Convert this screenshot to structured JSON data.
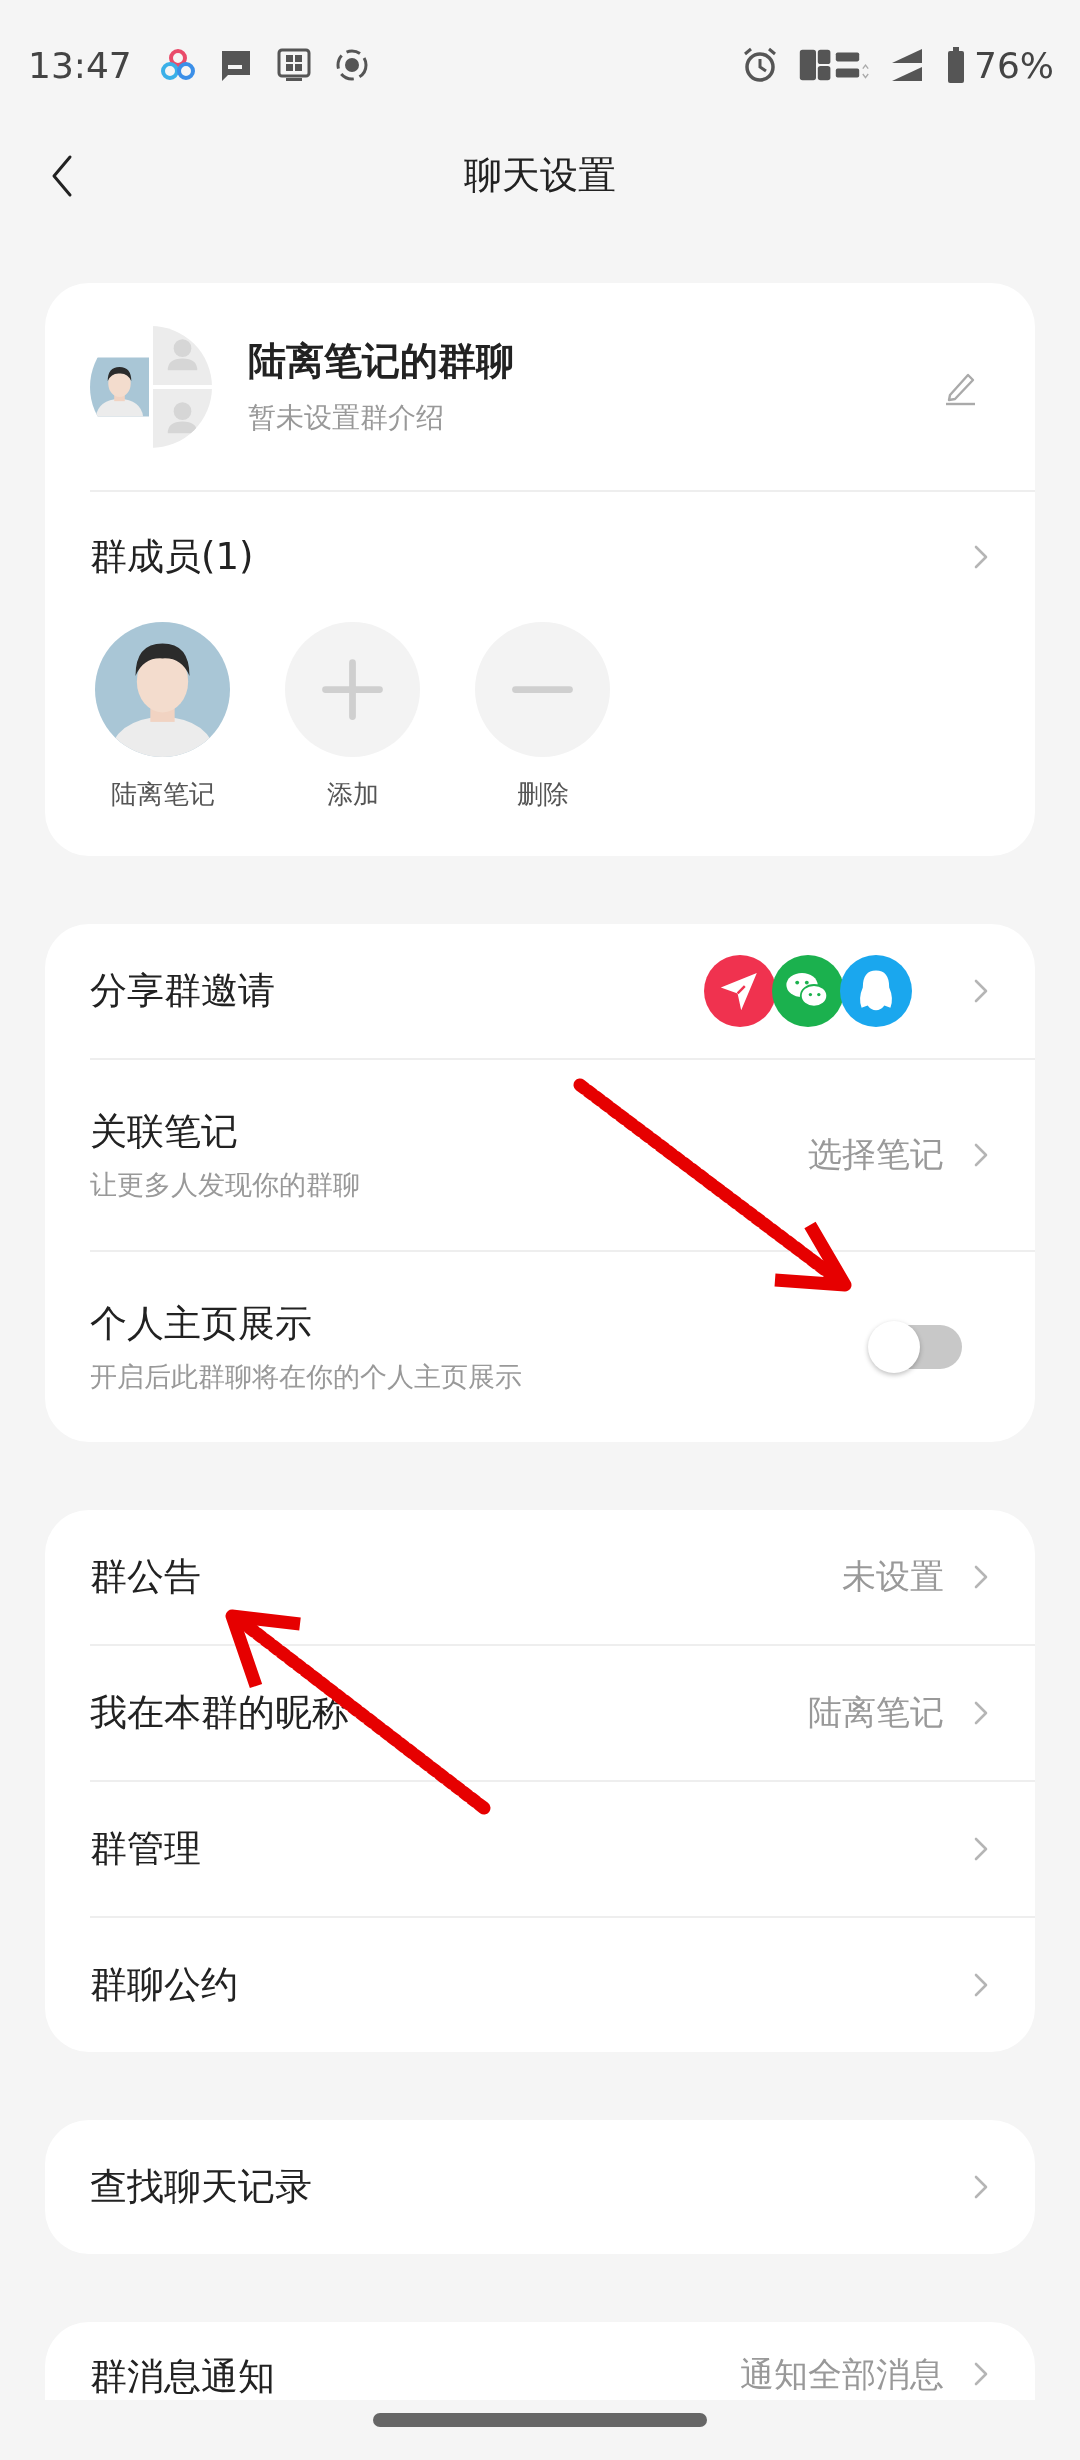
{
  "status_bar": {
    "time": "13:47",
    "battery": "76%"
  },
  "header": {
    "title": "聊天设置"
  },
  "group": {
    "name": "陆离笔记的群聊",
    "intro": "暂未设置群介绍"
  },
  "members": {
    "title": "群成员(1)",
    "items": [
      {
        "kind": "member",
        "label": "陆离笔记"
      },
      {
        "kind": "add",
        "label": "添加"
      },
      {
        "kind": "remove",
        "label": "删除"
      }
    ]
  },
  "sections": [
    {
      "rows": [
        {
          "kind": "share",
          "title": "分享群邀请"
        },
        {
          "kind": "link",
          "title": "关联笔记",
          "subtitle": "让更多人发现你的群聊",
          "value": "选择笔记"
        },
        {
          "kind": "toggle",
          "title": "个人主页展示",
          "subtitle": "开启后此群聊将在你的个人主页展示",
          "on": false
        }
      ]
    },
    {
      "rows": [
        {
          "kind": "link",
          "title": "群公告",
          "value": "未设置"
        },
        {
          "kind": "link",
          "title": "我在本群的昵称",
          "value": "陆离笔记"
        },
        {
          "kind": "link",
          "title": "群管理"
        },
        {
          "kind": "link",
          "title": "群聊公约"
        }
      ]
    },
    {
      "rows": [
        {
          "kind": "link",
          "title": "查找聊天记录"
        }
      ]
    },
    {
      "rows": [
        {
          "kind": "link",
          "title": "群消息通知",
          "value": "通知全部消息"
        }
      ]
    }
  ],
  "annotations": [
    {
      "kind": "arrow"
    },
    {
      "kind": "arrow"
    }
  ]
}
